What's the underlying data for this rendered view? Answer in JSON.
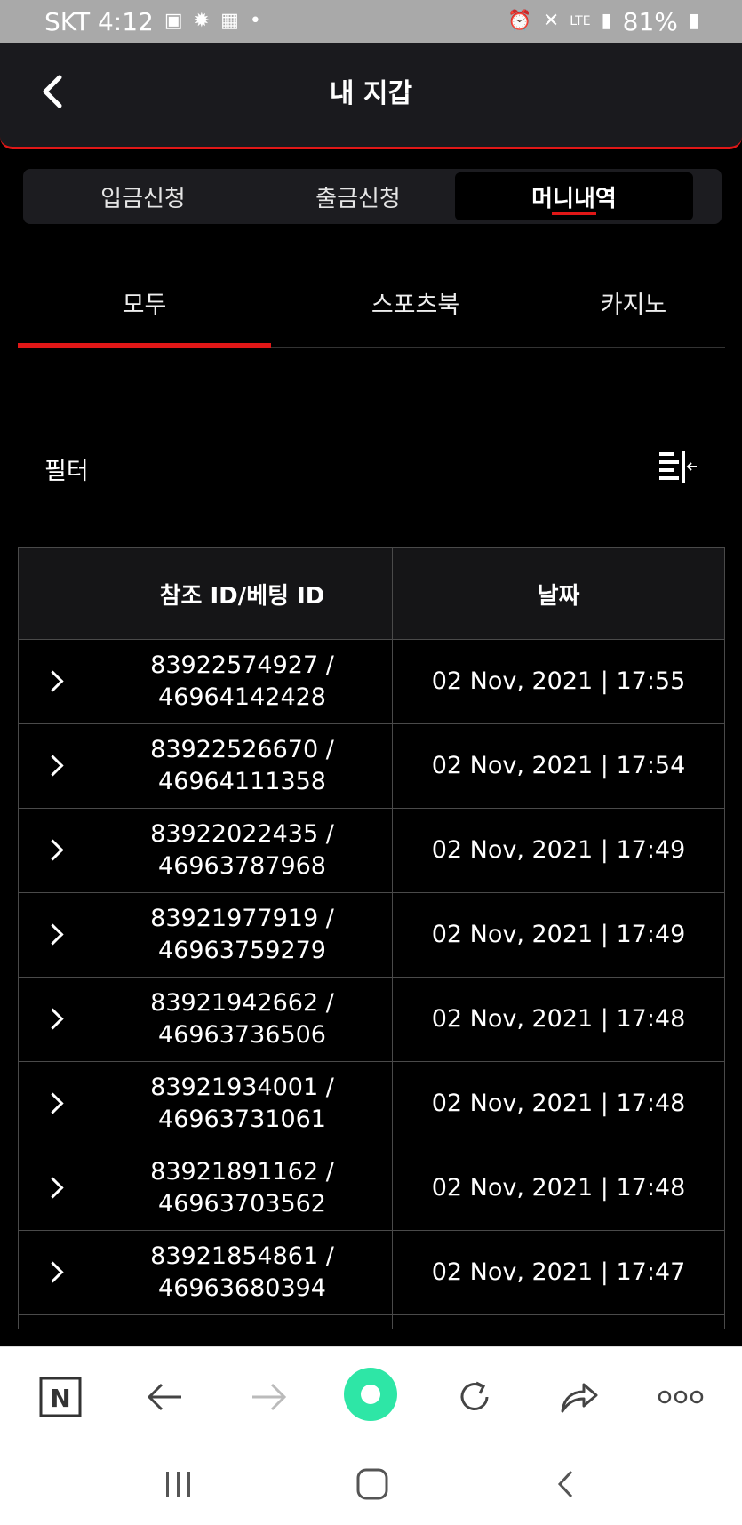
{
  "statusbar": {
    "carrier_time": "SKT 4:12",
    "battery": "81%",
    "network": "LTE"
  },
  "header": {
    "title": "내 지갑"
  },
  "segment": {
    "items": [
      "입금신청",
      "출금신청",
      "머니내역"
    ],
    "active_index": 2
  },
  "tabs": {
    "items": [
      "모두",
      "스포츠북",
      "카지노"
    ],
    "active_index": 0
  },
  "filter": {
    "label": "필터"
  },
  "table": {
    "headers": [
      "참조 ID/베팅 ID",
      "날짜"
    ],
    "rows": [
      {
        "ref": "83922574927 /",
        "bet": "46964142428",
        "date": "02 Nov, 2021 | 17:55"
      },
      {
        "ref": "83922526670 /",
        "bet": "46964111358",
        "date": "02 Nov, 2021 | 17:54"
      },
      {
        "ref": "83922022435 /",
        "bet": "46963787968",
        "date": "02 Nov, 2021 | 17:49"
      },
      {
        "ref": "83921977919 /",
        "bet": "46963759279",
        "date": "02 Nov, 2021 | 17:49"
      },
      {
        "ref": "83921942662 /",
        "bet": "46963736506",
        "date": "02 Nov, 2021 | 17:48"
      },
      {
        "ref": "83921934001 /",
        "bet": "46963731061",
        "date": "02 Nov, 2021 | 17:48"
      },
      {
        "ref": "83921891162 /",
        "bet": "46963703562",
        "date": "02 Nov, 2021 | 17:48"
      },
      {
        "ref": "83921854861 /",
        "bet": "46963680394",
        "date": "02 Nov, 2021 | 17:47"
      }
    ]
  },
  "browser": {
    "home_letter": "N"
  },
  "colors": {
    "accent": "#e01717",
    "background": "#000000",
    "bar": "#1a1a1e",
    "browser_accent": "#2ee6a6"
  }
}
